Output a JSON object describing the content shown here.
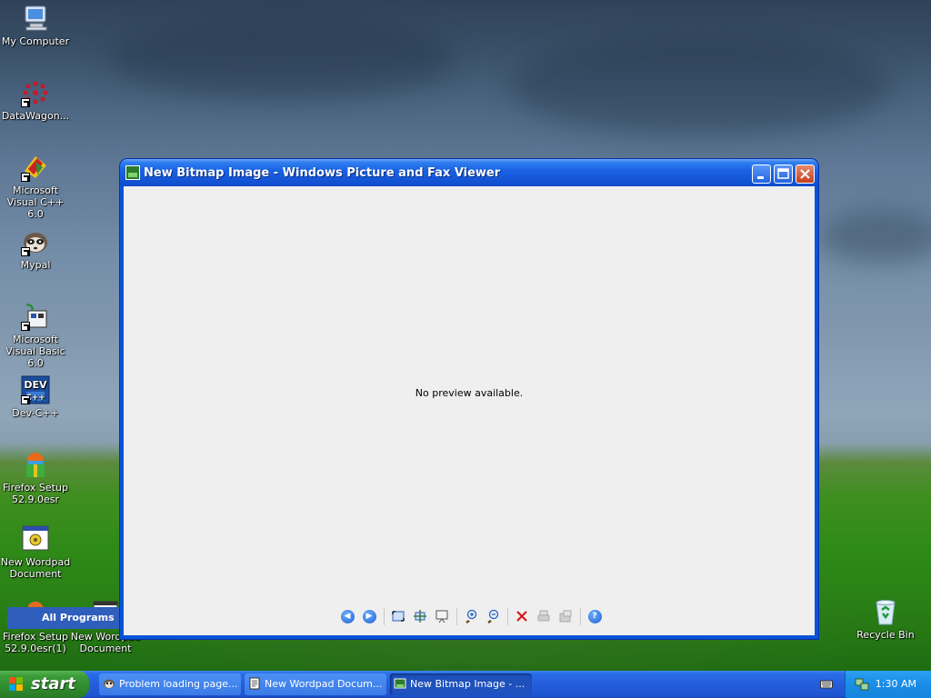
{
  "desktop": {
    "icons": [
      {
        "label": "My Computer"
      },
      {
        "label": "DataWagon..."
      },
      {
        "label": "Microsoft Visual C++ 6.0"
      },
      {
        "label": "Mypal"
      },
      {
        "label": "Microsoft Visual Basic 6.0"
      },
      {
        "label": "Dev-C++"
      },
      {
        "label": "Firefox Setup 52.9.0esr"
      },
      {
        "label": "New Wordpad Document"
      },
      {
        "label": "Firefox Setup 52.9.0esr(1)"
      },
      {
        "label": "New Wordpad Document"
      },
      {
        "label": "Recycle Bin"
      }
    ]
  },
  "window": {
    "title": "New Bitmap Image - Windows Picture and Fax Viewer",
    "message": "No preview available.",
    "toolbar": [
      "previous-image-icon",
      "next-image-icon",
      "best-fit-icon",
      "actual-size-icon",
      "slideshow-icon",
      "zoom-in-icon",
      "zoom-out-icon",
      "delete-icon",
      "print-icon",
      "copy-to-icon",
      "help-icon"
    ]
  },
  "start_menu": {
    "all_programs": "All Programs"
  },
  "taskbar": {
    "start_label": "start",
    "tasks": [
      {
        "label": "Problem loading page..."
      },
      {
        "label": "New Wordpad Docum..."
      },
      {
        "label": "New Bitmap Image - ..."
      }
    ],
    "clock": "1:30 AM"
  },
  "colors": {
    "titlebar": "#1558d8",
    "taskbar": "#245ddb",
    "start": "#3c9c3a",
    "tray": "#1a8de6"
  }
}
